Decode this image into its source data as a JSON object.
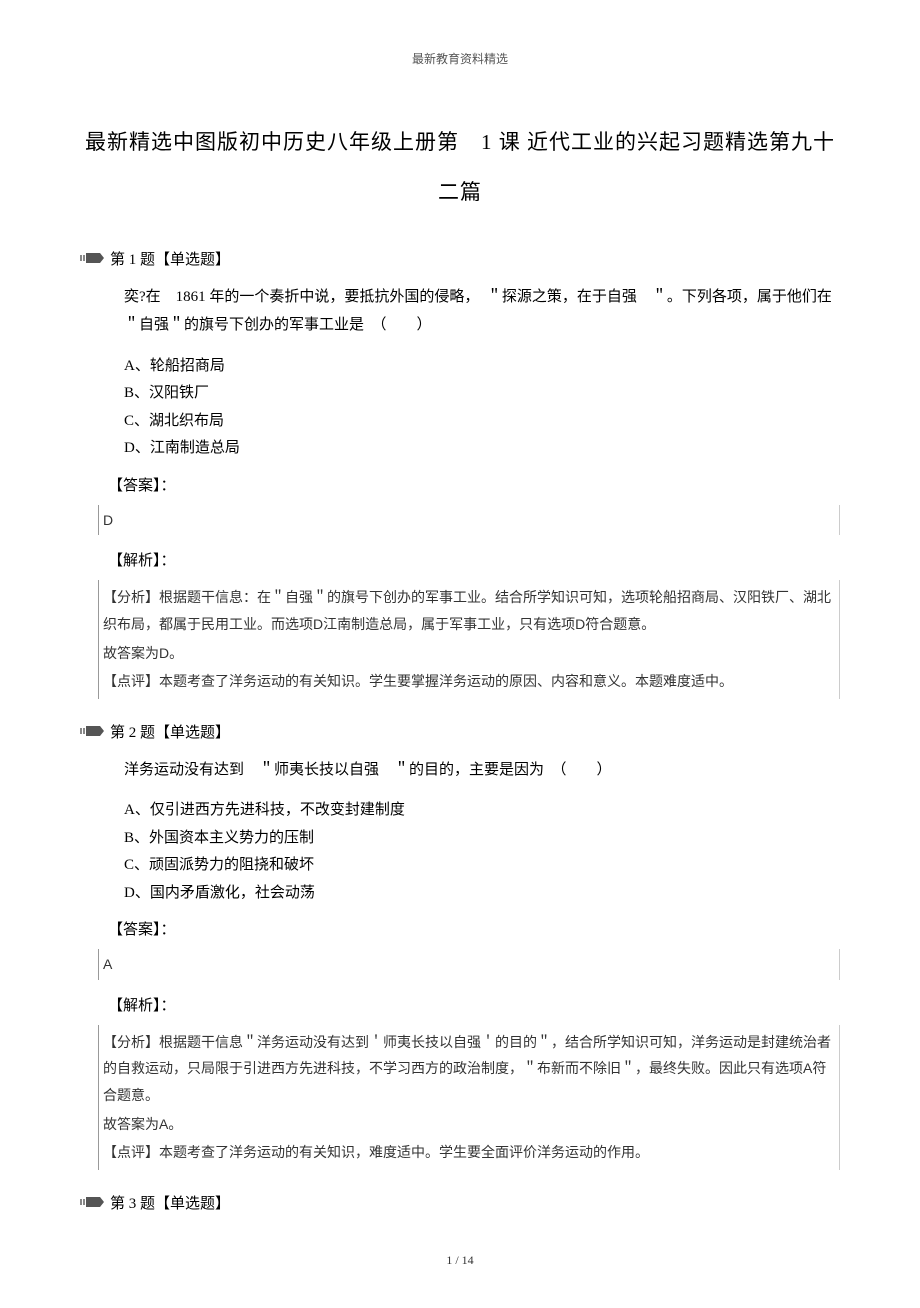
{
  "header": "最新教育资料精选",
  "title_line1": "最新精选中图版初中历史八年级上册第　1 课 近代工业的兴起习题精选第九十",
  "title_line2": "二篇",
  "questions": [
    {
      "header": "第 1 题【单选题】",
      "stem": "奕?在　1861 年的一个奏折中说，要抵抗外国的侵略，　＂探源之策，在于自强　＂。下列各项，属于他们在 ＂自强＂的旗号下创办的军事工业是　（　　）",
      "options": [
        "A、轮船招商局",
        "B、汉阳铁厂",
        "C、湖北织布局",
        "D、江南制造总局"
      ],
      "answer_label": "【答案】：",
      "answer": "D",
      "analysis_label": "【解析】：",
      "analysis": [
        "【分析】根据题干信息：在＂自强＂的旗号下创办的军事工业。结合所学知识可知，选项轮船招商局、汉阳铁厂、湖北织布局，都属于民用工业。而选项D江南制造总局，属于军事工业，只有选项D符合题意。",
        "故答案为D。",
        "【点评】本题考查了洋务运动的有关知识。学生要掌握洋务运动的原因、内容和意义。本题难度适中。"
      ]
    },
    {
      "header": "第 2 题【单选题】",
      "stem": "洋务运动没有达到　＂师夷长技以自强　＂的目的，主要是因为　（　　）",
      "options": [
        "A、仅引进西方先进科技，不改变封建制度",
        "B、外国资本主义势力的压制",
        "C、顽固派势力的阻挠和破坏",
        "D、国内矛盾激化，社会动荡"
      ],
      "answer_label": "【答案】：",
      "answer": "A",
      "analysis_label": "【解析】：",
      "analysis": [
        "【分析】根据题干信息＂洋务运动没有达到＇师夷长技以自强＇的目的＂，结合所学知识可知，洋务运动是封建统治者的自救运动，只局限于引进西方先进科技，不学习西方的政治制度，＂布新而不除旧＂，最终失败。因此只有选项A符合题意。",
        "故答案为A。",
        "",
        "【点评】本题考查了洋务运动的有关知识，难度适中。学生要全面评价洋务运动的作用。"
      ]
    },
    {
      "header": "第 3 题【单选题】"
    }
  ],
  "footer": "1 / 14"
}
